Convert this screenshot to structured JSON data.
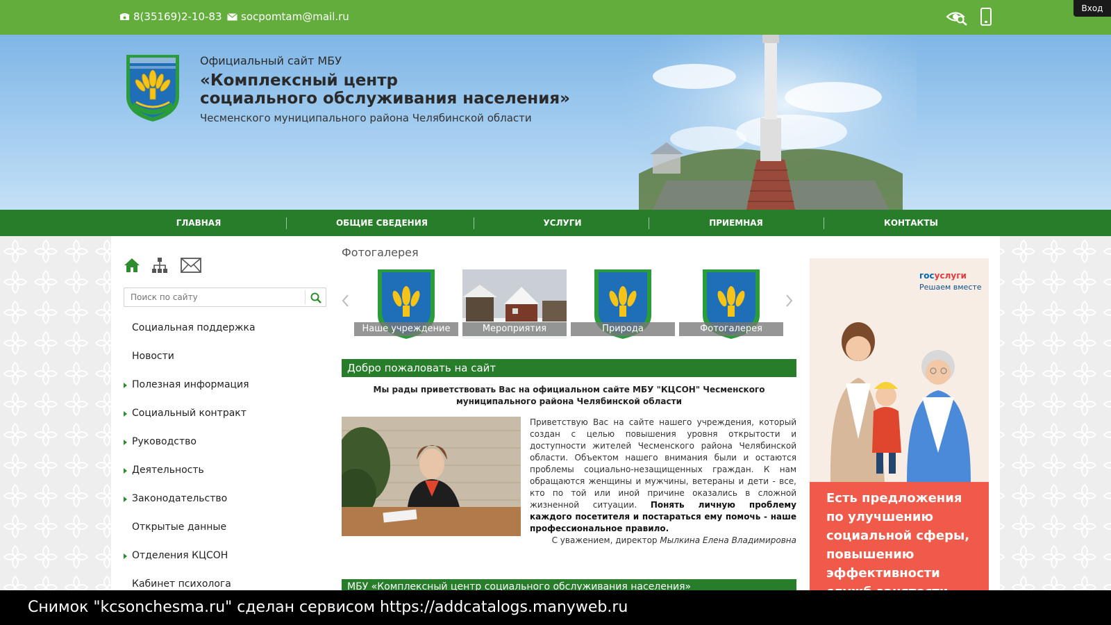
{
  "topbar": {
    "phone": "8(35169)2-10-83",
    "email": "socpomtam@mail.ru",
    "login_label": "Вход"
  },
  "header": {
    "subtitle": "Официальный сайт МБУ",
    "title_line1": "«Комплексный центр",
    "title_line2": "социального обслуживания населения»",
    "region": "Чесменского муниципального района Челябинской области"
  },
  "nav": {
    "items": [
      {
        "label": "ГЛАВНАЯ"
      },
      {
        "label": "ОБЩИЕ СВЕДЕНИЯ"
      },
      {
        "label": "УСЛУГИ"
      },
      {
        "label": "ПРИЕМНАЯ"
      },
      {
        "label": "КОНТАКТЫ"
      }
    ]
  },
  "search": {
    "placeholder": "Поиск по сайту"
  },
  "sidebar": {
    "items": [
      {
        "label": "Социальная поддержка",
        "has_arrow": false
      },
      {
        "label": "Новости",
        "has_arrow": false
      },
      {
        "label": "Полезная информация",
        "has_arrow": true
      },
      {
        "label": "Социальный контракт",
        "has_arrow": true
      },
      {
        "label": "Руководство",
        "has_arrow": true
      },
      {
        "label": "Деятельность",
        "has_arrow": true
      },
      {
        "label": "Законодательство",
        "has_arrow": true
      },
      {
        "label": "Открытые данные",
        "has_arrow": false
      },
      {
        "label": "Отделения КЦСОН",
        "has_arrow": true
      },
      {
        "label": "Кабинет психолога",
        "has_arrow": false
      }
    ]
  },
  "gallery": {
    "title": "Фотогалерея",
    "items": [
      {
        "caption": "Наше учреждение"
      },
      {
        "caption": "Мероприятия"
      },
      {
        "caption": "Природа"
      },
      {
        "caption": "Фотогалерея"
      }
    ]
  },
  "welcome": {
    "header": "Добро пожаловать на сайт",
    "lead": "Мы рады приветствовать Вас на официальном сайте МБУ \"КЦСОН\" Чесменского муниципального района Челябинской области",
    "body": "Приветствую Вас на сайте нашего учреждения, который создан с целью повышения уровня открытости и доступности жителей Чесменского района Челябинской области. Объектом нашего внимания были и остаются проблемы социально-незащищенных граждан. К нам обращаются женщины и мужчины, ветераны и дети - все, кто по той или иной причине оказались в сложной жизненной ситуации.",
    "body_bold": "Понять личную проблему каждого посетителя и постараться ему помочь - наше профессиональное правило.",
    "sign_prefix": "С уважением, директор",
    "sign_name": "Мылкина Елена Владимировна",
    "header2": "МБУ «Комплексный центр социального обслуживания населения»"
  },
  "banner": {
    "brand_part1": "гос",
    "brand_part2": "услуги",
    "brand_sub": "Решаем вместе",
    "text": "Есть предложения по улучшению социальной сферы, повышению эффективности служб занятости или"
  },
  "footer": {
    "text": "Снимок \"kcsonchesma.ru\" сделан сервисом https://addcatalogs.manyweb.ru"
  },
  "colors": {
    "topbar": "#63ad3c",
    "nav": "#277d2a",
    "banner_red": "#ef5a4a"
  }
}
